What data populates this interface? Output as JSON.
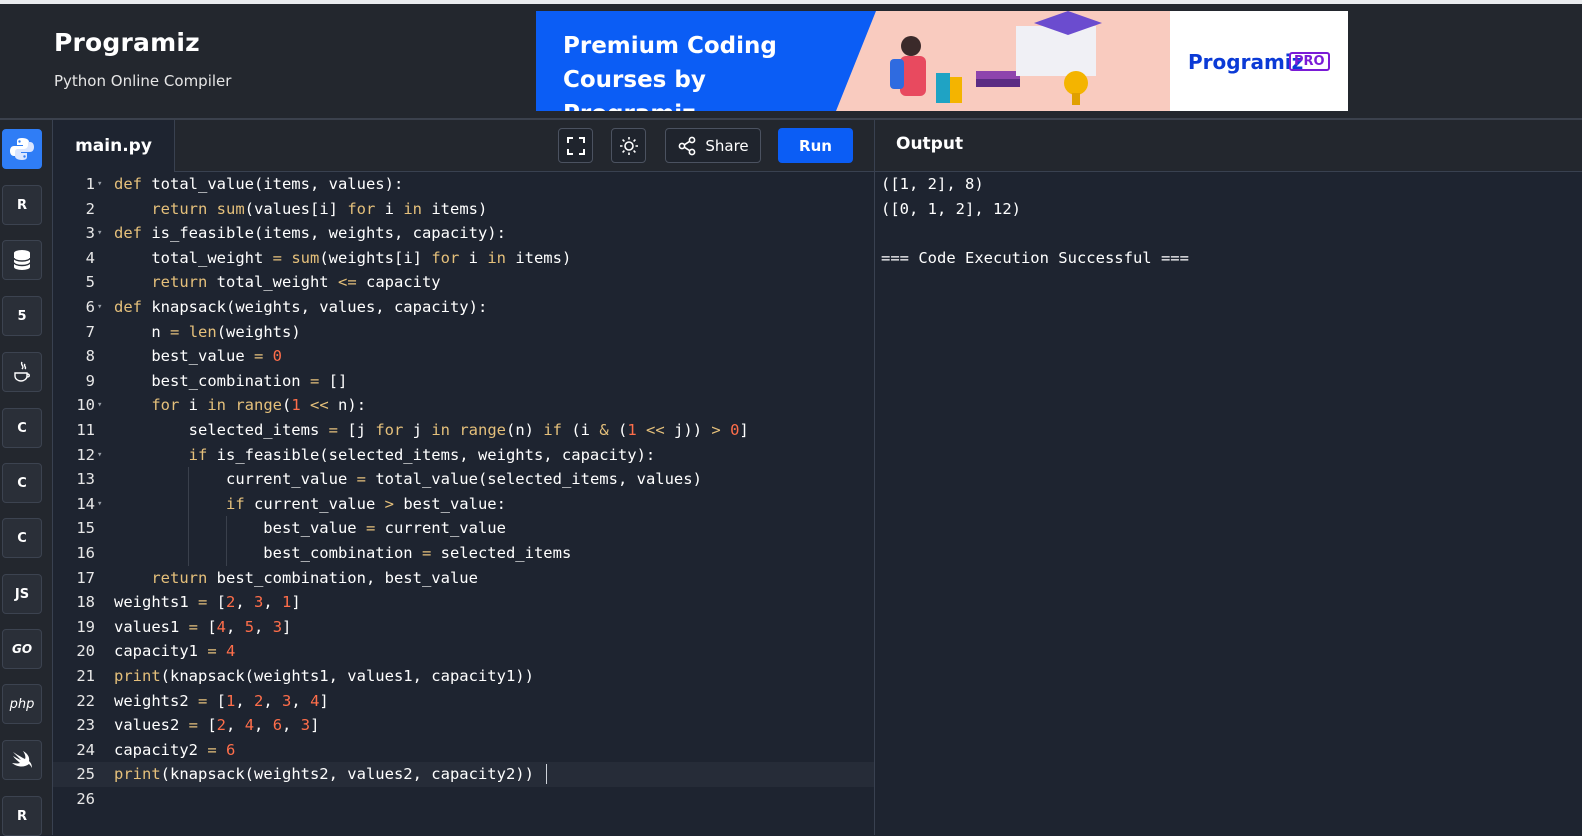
{
  "header": {
    "logo": "Programiz",
    "subtitle": "Python Online Compiler",
    "ad": {
      "line1": "Premium Coding",
      "line2": "Courses by Programiz",
      "brand": "Programiz",
      "badge": "PRO"
    }
  },
  "languages": [
    {
      "name": "python",
      "label": "",
      "active": true
    },
    {
      "name": "r",
      "label": "R"
    },
    {
      "name": "sql",
      "label": ""
    },
    {
      "name": "html",
      "label": "5"
    },
    {
      "name": "java",
      "label": ""
    },
    {
      "name": "c",
      "label": "C"
    },
    {
      "name": "cpp",
      "label": "C"
    },
    {
      "name": "csharp",
      "label": "C"
    },
    {
      "name": "javascript",
      "label": "JS"
    },
    {
      "name": "go",
      "label": "GO"
    },
    {
      "name": "php",
      "label": "php"
    },
    {
      "name": "swift",
      "label": ""
    },
    {
      "name": "rust",
      "label": "R"
    }
  ],
  "editor": {
    "tab_label": "main.py",
    "share_label": "Share",
    "run_label": "Run",
    "lines": [
      "def total_value(items, values):",
      "    return sum(values[i] for i in items)",
      "def is_feasible(items, weights, capacity):",
      "    total_weight = sum(weights[i] for i in items)",
      "    return total_weight <= capacity",
      "def knapsack(weights, values, capacity):",
      "    n = len(weights)",
      "    best_value = 0",
      "    best_combination = []",
      "    for i in range(1 << n):",
      "        selected_items = [j for j in range(n) if (i & (1 << j)) > 0]",
      "        if is_feasible(selected_items, weights, capacity):",
      "            current_value = total_value(selected_items, values)",
      "            if current_value > best_value:",
      "                best_value = current_value",
      "                best_combination = selected_items",
      "    return best_combination, best_value",
      "weights1 = [2, 3, 1]",
      "values1 = [4, 5, 3]",
      "capacity1 = 4",
      "print(knapsack(weights1, values1, capacity1))",
      "weights2 = [1, 2, 3, 4]",
      "values2 = [2, 4, 6, 3]",
      "capacity2 = 6",
      "print(knapsack(weights2, values2, capacity2))",
      ""
    ],
    "fold_lines": [
      1,
      3,
      6,
      10,
      12,
      14
    ],
    "current_line": 25
  },
  "output": {
    "title": "Output",
    "lines": [
      "([1, 2], 8)",
      "([0, 1, 2], 12)",
      "",
      "=== Code Execution Successful ==="
    ]
  }
}
